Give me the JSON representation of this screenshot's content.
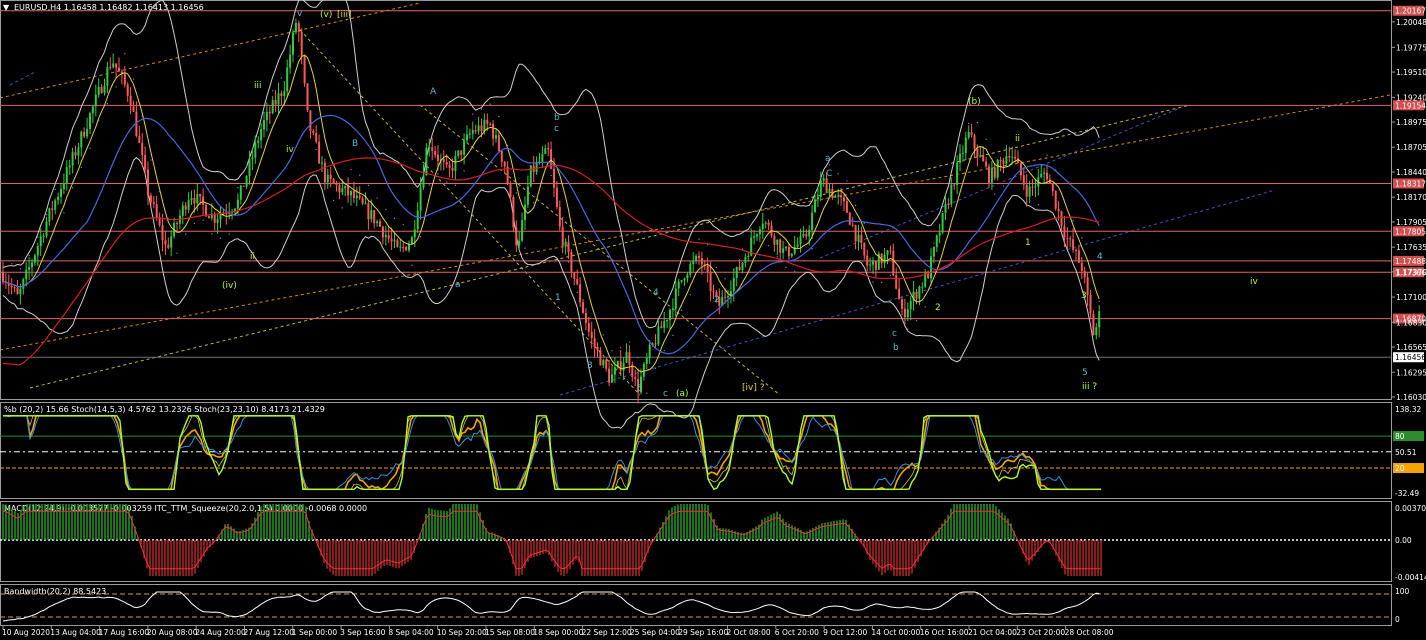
{
  "colors": {
    "background": "#000000",
    "axis": "#9a9a9a",
    "bull_candle": "#2ecc40",
    "bear_candle": "#ff5a5a",
    "hline": "#e06666",
    "price_box": "#d25050",
    "yellow": "#e6d33c",
    "orange": "#f4a300",
    "blue": "#4a66d8",
    "red_ma": "#d22222",
    "lime": "#aaff33",
    "white": "#ffffff",
    "cyan": "#5fb9c9",
    "macd_pos": "#27a727",
    "macd_neg": "#c62828"
  },
  "header": {
    "symbol_line": "EURUSD,H4  1.16458  1.16482  1.16413  1.16456"
  },
  "chart_data": [
    {
      "type": "candlestick",
      "panel": "price",
      "title": "EURUSD,H4  1.16458  1.16482  1.16413  1.16456",
      "ylim": [
        1.1603,
        1.2025
      ],
      "y_ticks": [
        "1.20048",
        "1.19775",
        "1.19510",
        "1.19240",
        "1.18975",
        "1.18705",
        "1.18440",
        "1.18170",
        "1.17905",
        "1.17635",
        "1.17370",
        "1.17100",
        "1.16830",
        "1.16565",
        "1.16295",
        "1.16030"
      ],
      "y_tick_values": [
        1.20048,
        1.19775,
        1.1951,
        1.1924,
        1.18975,
        1.18705,
        1.1844,
        1.1817,
        1.17905,
        1.17635,
        1.1737,
        1.171,
        1.1683,
        1.16565,
        1.16295,
        1.1603
      ],
      "x_tick_labels": [
        "10 Aug 2020",
        "13 Aug 04:00",
        "17 Aug 16:00",
        "20 Aug 08:00",
        "24 Aug 20:00",
        "27 Aug 12:00",
        "1 Sep 00:00",
        "3 Sep 16:00",
        "8 Sep 04:00",
        "10 Sep 20:00",
        "15 Sep 08:00",
        "18 Sep 00:00",
        "22 Sep 12:00",
        "25 Sep 04:00",
        "29 Sep 16:00",
        "2 Oct 08:00",
        "6 Oct 20:00",
        "9 Oct 12:00",
        "14 Oct 00:00",
        "16 Oct 16:00",
        "21 Oct 04:00",
        "23 Oct 20:00",
        "28 Oct 08:00"
      ],
      "horizontal_levels": [
        {
          "label": "1.20167",
          "value": 1.20167
        },
        {
          "label": "1.19154",
          "value": 1.19154
        },
        {
          "label": "1.18317",
          "value": 1.18317
        },
        {
          "label": "1.17805",
          "value": 1.17805
        },
        {
          "label": "1.17488",
          "value": 1.17488
        },
        {
          "label": "1.17366",
          "value": 1.17366
        },
        {
          "label": "1.16870",
          "value": 1.1687
        }
      ],
      "current_price": {
        "label": "1.16456",
        "value": 1.16456
      },
      "price_path": [
        [
          0,
          1.174
        ],
        [
          18,
          1.1709
        ],
        [
          48,
          1.1795
        ],
        [
          78,
          1.1872
        ],
        [
          112,
          1.1965
        ],
        [
          130,
          1.1925
        ],
        [
          148,
          1.1823
        ],
        [
          166,
          1.1762
        ],
        [
          190,
          1.1822
        ],
        [
          214,
          1.1795
        ],
        [
          238,
          1.1812
        ],
        [
          262,
          1.1893
        ],
        [
          284,
          1.1935
        ],
        [
          297,
          1.2011
        ],
        [
          308,
          1.1898
        ],
        [
          326,
          1.1835
        ],
        [
          352,
          1.1818
        ],
        [
          376,
          1.1792
        ],
        [
          398,
          1.1758
        ],
        [
          412,
          1.1772
        ],
        [
          428,
          1.1878
        ],
        [
          448,
          1.1842
        ],
        [
          472,
          1.1888
        ],
        [
          490,
          1.1895
        ],
        [
          505,
          1.1851
        ],
        [
          518,
          1.1758
        ],
        [
          530,
          1.1842
        ],
        [
          548,
          1.1866
        ],
        [
          560,
          1.1782
        ],
        [
          575,
          1.1728
        ],
        [
          590,
          1.1668
        ],
        [
          610,
          1.1622
        ],
        [
          628,
          1.165
        ],
        [
          637,
          1.161
        ],
        [
          650,
          1.1652
        ],
        [
          668,
          1.1692
        ],
        [
          685,
          1.1738
        ],
        [
          700,
          1.1752
        ],
        [
          718,
          1.1699
        ],
        [
          740,
          1.1742
        ],
        [
          762,
          1.1795
        ],
        [
          785,
          1.1756
        ],
        [
          805,
          1.1772
        ],
        [
          822,
          1.1835
        ],
        [
          846,
          1.1805
        ],
        [
          868,
          1.1742
        ],
        [
          890,
          1.1756
        ],
        [
          902,
          1.1691
        ],
        [
          928,
          1.1735
        ],
        [
          950,
          1.1822
        ],
        [
          968,
          1.1885
        ],
        [
          990,
          1.1838
        ],
        [
          1010,
          1.1868
        ],
        [
          1028,
          1.1822
        ],
        [
          1046,
          1.1845
        ],
        [
          1066,
          1.1775
        ],
        [
          1082,
          1.1742
        ],
        [
          1094,
          1.1668
        ],
        [
          1102,
          1.1702
        ],
        [
          1112,
          1.1652
        ],
        [
          1118,
          1.1668
        ],
        [
          1126,
          1.16456
        ],
        [
          1130,
          1.1645
        ]
      ],
      "wave_labels": [
        "v",
        "(v)",
        "[iii]",
        "iii",
        "iv",
        "ii",
        "(iv)",
        "A",
        "b",
        "c",
        "a",
        "B",
        "1",
        "2",
        "3",
        "4",
        "5",
        "c",
        "(a)",
        "[iv] ?",
        "(b)",
        "C",
        "b",
        "ii",
        "iv",
        "iii ?",
        "2",
        "3",
        "4",
        "5",
        "1",
        "c",
        "a"
      ]
    },
    {
      "type": "line",
      "panel": "oscillator",
      "title": "%b (20,2) 15.66   Stoch(14,5,3) 4.5762 13.2326   Stoch(23,23,10) 8.4173 21.4329",
      "y_ticks": [
        "138.32",
        "50.51",
        "-32.49"
      ],
      "levels": [
        {
          "label": "80",
          "value": 80
        },
        {
          "label": "50.51",
          "value": 50.51
        },
        {
          "label": "20",
          "value": 20
        }
      ],
      "series": [
        {
          "name": "%b (20,2)",
          "last": 15.66
        },
        {
          "name": "Stoch(14,5,3)",
          "last": 4.5762,
          "signal": 13.2326
        },
        {
          "name": "Stoch(23,23,10)",
          "last": 8.4173,
          "signal": 21.4329
        }
      ]
    },
    {
      "type": "bar",
      "panel": "macd",
      "title": "MACD(12,24,9) -0.003577 -0.003259   ITC_TTM_Squeeze(20,2.0,1.5) 0.0000 -0.0068 0.0000",
      "y_ticks": [
        "0.003709",
        "0.00",
        "-0.004141"
      ],
      "series": [
        {
          "name": "MACD(12,24,9)",
          "last": -0.003577,
          "signal": -0.003259
        },
        {
          "name": "ITC_TTM_Squeeze(20,2.0,1.5)",
          "values": [
            0.0,
            -0.0068,
            0.0
          ]
        }
      ]
    },
    {
      "type": "line",
      "panel": "bandwidth",
      "title": "Bandwidth(20,2) 88.5423",
      "y_ticks": [
        "100",
        "0"
      ],
      "series": [
        {
          "name": "Bandwidth(20,2)",
          "last": 88.5423
        }
      ]
    }
  ]
}
